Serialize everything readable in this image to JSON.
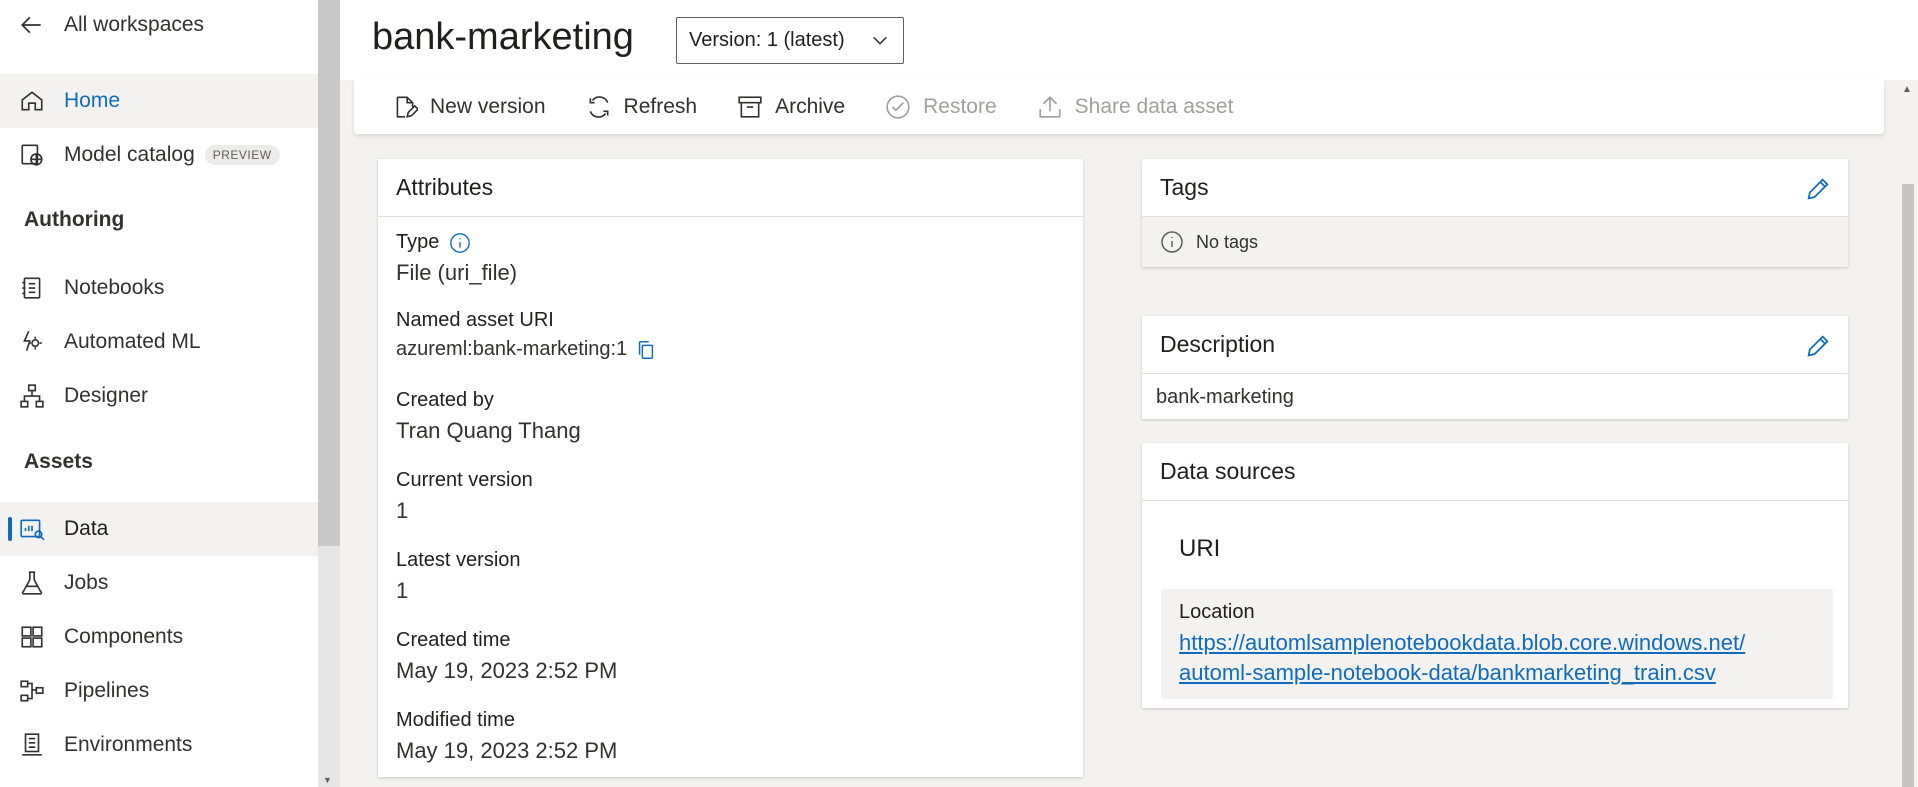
{
  "sidebar": {
    "back_label": "All workspaces",
    "items": [
      {
        "label": "Home"
      },
      {
        "label": "Model catalog",
        "badge": "PREVIEW"
      },
      {
        "label": "Notebooks"
      },
      {
        "label": "Automated ML"
      },
      {
        "label": "Designer"
      },
      {
        "label": "Data"
      },
      {
        "label": "Jobs"
      },
      {
        "label": "Components"
      },
      {
        "label": "Pipelines"
      },
      {
        "label": "Environments"
      }
    ],
    "sections": {
      "authoring": "Authoring",
      "assets": "Assets"
    }
  },
  "header": {
    "title": "bank-marketing",
    "version_select": "Version: 1 (latest)"
  },
  "toolbar": {
    "new_version": "New version",
    "refresh": "Refresh",
    "archive": "Archive",
    "restore": "Restore",
    "share": "Share data asset"
  },
  "attributes": {
    "heading": "Attributes",
    "type_label": "Type",
    "type_value": "File (uri_file)",
    "uri_label": "Named asset URI",
    "uri_value": "azureml:bank-marketing:1",
    "created_by_label": "Created by",
    "created_by_value": "Tran Quang Thang",
    "current_version_label": "Current version",
    "current_version_value": "1",
    "latest_version_label": "Latest version",
    "latest_version_value": "1",
    "created_time_label": "Created time",
    "created_time_value": "May 19, 2023 2:52 PM",
    "modified_time_label": "Modified time",
    "modified_time_value": "May 19, 2023 2:52 PM"
  },
  "tags": {
    "heading": "Tags",
    "empty_text": "No tags"
  },
  "description": {
    "heading": "Description",
    "text": "bank-marketing"
  },
  "data_sources": {
    "heading": "Data sources",
    "uri_heading": "URI",
    "location_label": "Location",
    "location_line1": "https://automlsamplenotebookdata.blob.core.windows.net/",
    "location_line2": "automl-sample-notebook-data/bankmarketing_train.csv"
  },
  "colors": {
    "accent": "#0f6cbd",
    "disabled": "#a19f9d"
  }
}
